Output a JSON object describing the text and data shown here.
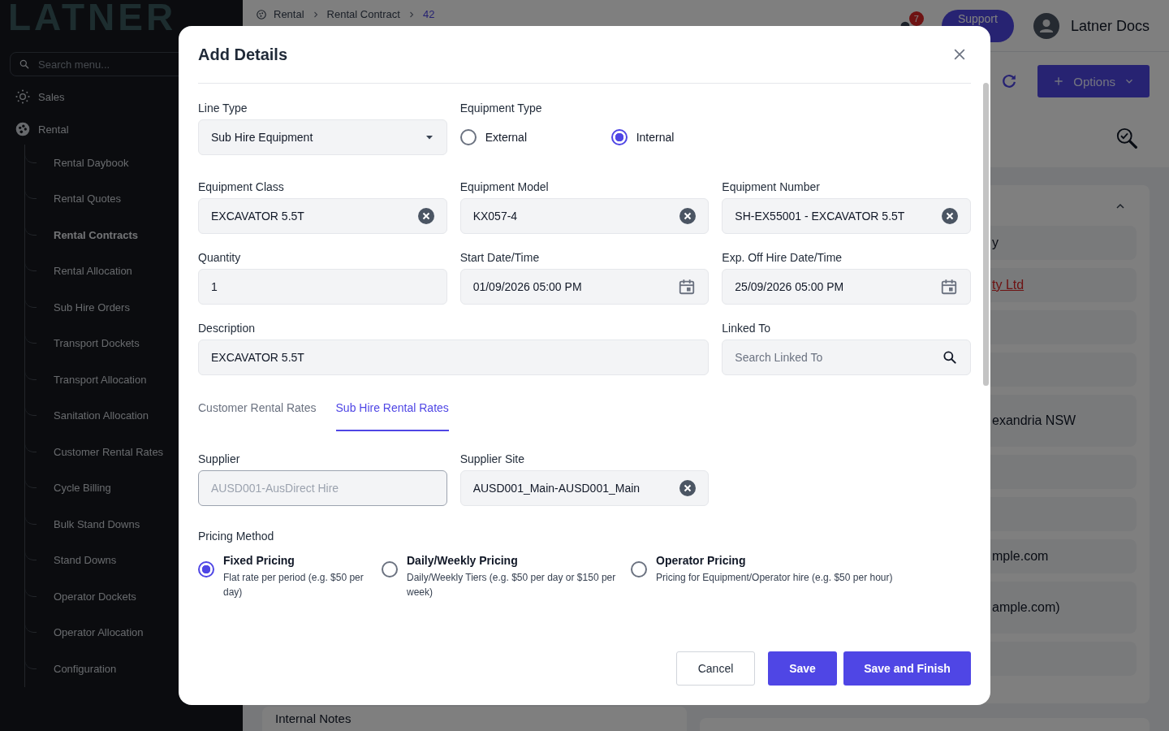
{
  "sidebar": {
    "logo": "LATNER",
    "search": {
      "placeholder": "Search menu..."
    },
    "items": [
      {
        "label": "Sales"
      },
      {
        "label": "Rental",
        "children": [
          {
            "label": "Rental Daybook",
            "selected": false
          },
          {
            "label": "Rental Quotes",
            "selected": false
          },
          {
            "label": "Rental Contracts",
            "selected": true
          },
          {
            "label": "Rental Allocation",
            "selected": false
          },
          {
            "label": "Sub Hire Orders",
            "selected": false
          },
          {
            "label": "Transport Dockets",
            "selected": false
          },
          {
            "label": "Transport Allocation",
            "selected": false
          },
          {
            "label": "Sanitation Allocation",
            "selected": false
          },
          {
            "label": "Customer Rental Rates",
            "selected": false
          },
          {
            "label": "Cycle Billing",
            "selected": false
          },
          {
            "label": "Bulk Stand Downs",
            "selected": false
          },
          {
            "label": "Stand Downs",
            "selected": false
          },
          {
            "label": "Operator Dockets",
            "selected": false
          },
          {
            "label": "Operator Allocation",
            "selected": false
          },
          {
            "label": "Configuration",
            "selected": false
          }
        ]
      }
    ]
  },
  "header": {
    "breadcrumb": [
      "Rental",
      "Rental Contract",
      "42"
    ],
    "notification_count": "7",
    "support_button": "Support",
    "user_name": "Latner Docs"
  },
  "toolbar": {
    "options_button": "Options"
  },
  "detail_panel": {
    "rows": [
      {
        "text": "y",
        "kind": "text"
      },
      {
        "text": "ty Ltd",
        "kind": "link"
      },
      {
        "text": "",
        "kind": "empty"
      },
      {
        "text": "",
        "kind": "empty"
      },
      {
        "text": "exandria NSW",
        "kind": "tall"
      },
      {
        "text": "",
        "kind": "empty"
      },
      {
        "text": "",
        "kind": "empty"
      },
      {
        "text": "mple.com",
        "kind": "text"
      },
      {
        "text": "ample.com)",
        "kind": "tall"
      },
      {
        "text": "",
        "kind": "empty"
      }
    ]
  },
  "notes_tab": "Internal Notes",
  "modal": {
    "title": "Add Details",
    "rows": [
      [
        {
          "kind": "select",
          "label": "Line Type",
          "value": "Sub Hire Equipment"
        },
        {
          "kind": "radio",
          "label": "Equipment Type",
          "options": [
            {
              "label": "External",
              "selected": false
            },
            {
              "label": "Internal",
              "selected": true
            }
          ]
        },
        ""
      ],
      [
        {
          "kind": "clearable",
          "label": "Equipment Class",
          "value": "EXCAVATOR 5.5T"
        },
        {
          "kind": "clearable",
          "label": "Equipment Model",
          "value": "KX057-4"
        },
        {
          "kind": "clearable",
          "label": "Equipment Number",
          "value": "SH-EX55001 - EXCAVATOR 5.5T"
        }
      ],
      [
        {
          "kind": "text",
          "label": "Quantity",
          "value": "1"
        },
        {
          "kind": "date",
          "label": "Start Date/Time",
          "value": "01/09/2026 05:00 PM"
        },
        {
          "kind": "date",
          "label": "Exp. Off Hire Date/Time",
          "value": "25/09/2026 05:00 PM"
        }
      ],
      [
        {
          "kind": "text",
          "label": "Description",
          "value": "EXCAVATOR 5.5T"
        },
        "",
        {
          "kind": "search",
          "label": "Linked To",
          "placeholder": "Search Linked To"
        }
      ]
    ],
    "tabs": [
      {
        "label": "Customer Rental Rates",
        "selected": false
      },
      {
        "label": "Sub Hire Rental Rates",
        "selected": true
      }
    ],
    "supplier_row": [
      {
        "kind": "locked",
        "label": "Supplier",
        "value": "AUSD001-AusDirect Hire"
      },
      {
        "kind": "clearable",
        "label": "Supplier Site",
        "value": "AUSD001_Main-AUSD001_Main"
      }
    ],
    "pricing_method": {
      "label": "Pricing Method",
      "options": [
        {
          "title": "Fixed Pricing",
          "description": "Flat rate per period (e.g. $50 per day)",
          "selected": true
        },
        {
          "title": "Daily/Weekly Pricing",
          "description": "Daily/Weekly Tiers (e.g. $50 per day or $150 per week)",
          "selected": false
        },
        {
          "title": "Operator Pricing",
          "description": "Pricing for Equipment/Operator hire (e.g. $50 per hour)",
          "selected": false
        }
      ]
    },
    "buttons": [
      {
        "label": "Cancel",
        "kind": "secondary"
      },
      {
        "label": "Save",
        "kind": "primary"
      },
      {
        "label": "Save and Finish",
        "kind": "primary"
      }
    ]
  }
}
